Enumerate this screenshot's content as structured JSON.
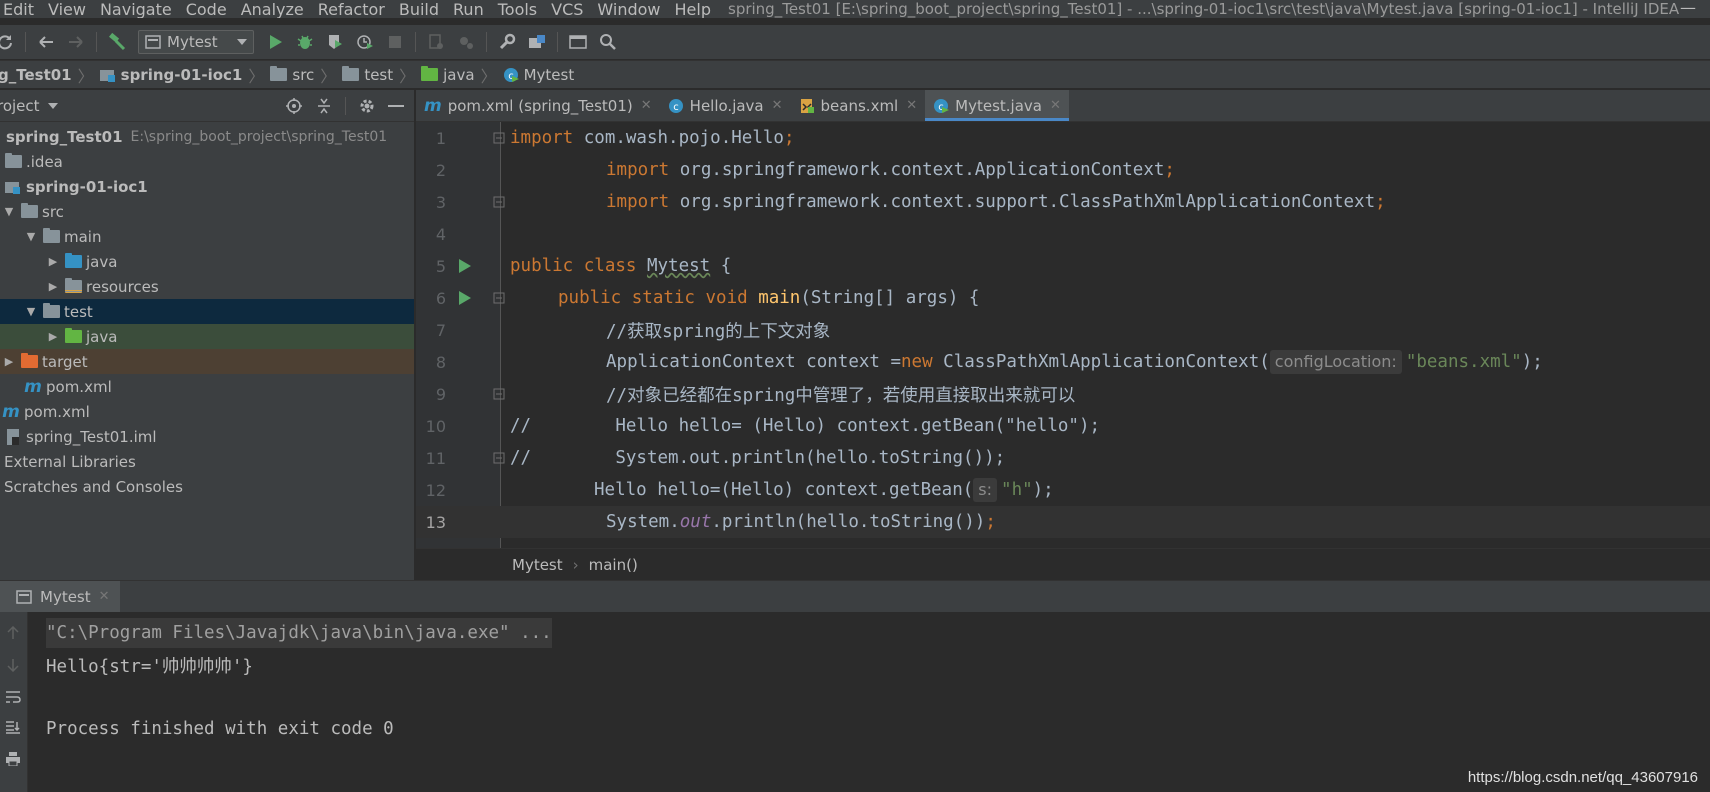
{
  "menubar": {
    "items": [
      "Edit",
      "View",
      "Navigate",
      "Code",
      "Analyze",
      "Refactor",
      "Build",
      "Run",
      "Tools",
      "VCS",
      "Window",
      "Help"
    ],
    "window_title": "spring_Test01 [E:\\spring_boot_project\\spring_Test01] - ...\\spring-01-ioc1\\src\\test\\java\\Mytest.java [spring-01-ioc1] - IntelliJ IDEA",
    "minimize": "—"
  },
  "toolbar": {
    "run_config": "Mytest",
    "icons": [
      "sync-icon",
      "back-icon",
      "forward-icon",
      "build-hammer-icon",
      "run-icon",
      "debug-icon",
      "coverage-icon",
      "profile-icon",
      "stop-icon",
      "settings-wrench-icon",
      "project-structure-icon",
      "terminal-icon",
      "search-icon"
    ]
  },
  "navbar": {
    "crumbs": [
      "g_Test01",
      "spring-01-ioc1",
      "src",
      "test",
      "java",
      "Mytest"
    ]
  },
  "project": {
    "header": "roject",
    "tree": [
      {
        "label": "spring_Test01",
        "path": "E:\\spring_boot_project\\spring_Test01"
      },
      {
        "label": ".idea"
      },
      {
        "label": "spring-01-ioc1"
      },
      {
        "label": "src"
      },
      {
        "label": "main"
      },
      {
        "label": "java"
      },
      {
        "label": "resources"
      },
      {
        "label": "test"
      },
      {
        "label": "java"
      },
      {
        "label": "target"
      },
      {
        "label": "pom.xml"
      },
      {
        "label": "pom.xml"
      },
      {
        "label": "spring_Test01.iml"
      },
      {
        "label": "External Libraries"
      },
      {
        "label": "Scratches and Consoles"
      }
    ]
  },
  "editor": {
    "tabs": [
      {
        "label": "pom.xml (spring_Test01)",
        "icon": "maven-icon"
      },
      {
        "label": "Hello.java",
        "icon": "class-icon"
      },
      {
        "label": "beans.xml",
        "icon": "xml-icon"
      },
      {
        "label": "Mytest.java",
        "icon": "test-class-icon",
        "active": true
      }
    ],
    "close_glyph": "✕",
    "line_numbers": [
      "1",
      "2",
      "3",
      "4",
      "5",
      "6",
      "7",
      "8",
      "9",
      "10",
      "11",
      "12",
      "13"
    ],
    "code": {
      "l1": {
        "kw": "import",
        "rest": " com.wash.pojo.Hello",
        "semi": ";"
      },
      "l2": {
        "kw": "import",
        "rest": " org.springframework.context.ApplicationContext",
        "semi": ";"
      },
      "l3": {
        "kw": "import",
        "rest": " org.springframework.context.support.ClassPathXmlApplicationContext",
        "semi": ";"
      },
      "l5": {
        "kw": "public class",
        "name": "Mytest",
        "rest": " {"
      },
      "l6": {
        "kw": "public static void",
        "fn": "main",
        "rest": "(String[] args) {"
      },
      "l7": {
        "comment": "//获取spring的上下文对象"
      },
      "l8": {
        "pre": "ApplicationContext context =",
        "kw": "new",
        "post": " ClassPathXmlApplicationContext(",
        "hint": "configLocation:",
        "str": "\"beans.xml\"",
        "end": ");"
      },
      "l9": {
        "comment": "//对象已经都在spring中管理了，若使用直接取出来就可以"
      },
      "l10": {
        "comment": "//        Hello hello= (Hello) context.getBean(\"hello\");"
      },
      "l11": {
        "comment": "//        System.out.println(hello.toString());"
      },
      "l12": {
        "pre": "Hello hello=(Hello) context.getBean(",
        "hint": "s:",
        "str": "\"h\"",
        "end": ");"
      },
      "l13": {
        "pre": "System.",
        "field": "out",
        "post": ".println(hello.toString())",
        "semi": ";"
      }
    }
  },
  "editor_breadcrumb": {
    "class": "Mytest",
    "sep": "›",
    "method": "main()"
  },
  "run": {
    "tab_label": "Mytest",
    "console": {
      "command": "\"C:\\Program Files\\Javajdk\\java\\bin\\java.exe\" ...",
      "output": "Hello{str='帅帅帅帅'}",
      "exit": "Process finished with exit code 0"
    }
  },
  "watermark": "https://blog.csdn.net/qq_43607916",
  "colors": {
    "keyword": "#cc7832",
    "string": "#6a8759",
    "comment": "#808080",
    "method": "#ffc66d",
    "field": "#9876aa",
    "accent": "#4a88c7",
    "run_green": "#59a869"
  }
}
